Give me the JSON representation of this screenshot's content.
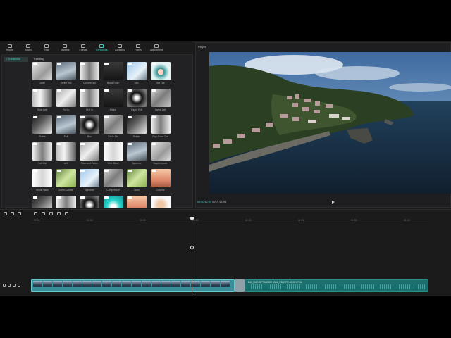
{
  "toolbar": {
    "items": [
      {
        "label": "Import",
        "icon": "import-icon"
      },
      {
        "label": "Audio",
        "icon": "audio-icon"
      },
      {
        "label": "Text",
        "icon": "text-icon"
      },
      {
        "label": "Stickers",
        "icon": "stickers-icon"
      },
      {
        "label": "Effects",
        "icon": "effects-icon"
      },
      {
        "label": "Transitions",
        "icon": "transitions-icon",
        "active": true
      },
      {
        "label": "Captions",
        "icon": "captions-icon"
      },
      {
        "label": "Filters",
        "icon": "filters-icon"
      },
      {
        "label": "Adjustment",
        "icon": "adjustment-icon"
      }
    ]
  },
  "leftpanel": {
    "category": "• Transitions",
    "section": "Trending",
    "items": [
      "Slide",
      "Scribe Bot",
      "Compress II",
      "Black Fade",
      "Mix",
      "Get Out",
      "Slide Left",
      "Pull In",
      "Pull In",
      "Blinds",
      "Paper Roll",
      "Swipe Left",
      "Shake",
      "Pull",
      "Blur",
      "Circle Sth",
      "Rotate",
      "Pop Zoom Out",
      "Pull Out",
      "Left",
      "Diamond Zoom",
      "Grid Gloss",
      "Squeeze",
      "Superimpose",
      "White Flash",
      "Zoom Canvas",
      "Shimmer",
      "Compressor",
      "Cube",
      "Colorful",
      "",
      "",
      "",
      "",
      "",
      ""
    ],
    "thumb_classes": [
      "t1",
      "t2",
      "t3",
      "t4",
      "t5",
      "t6",
      "t7",
      "t8",
      "t3",
      "t4",
      "t9",
      "t10",
      "t13",
      "t2",
      "t9",
      "t10",
      "t13",
      "t3",
      "t3",
      "t7",
      "t8",
      "t11",
      "t2",
      "t1",
      "t11",
      "t12",
      "t5",
      "t10",
      "t12",
      "t14",
      "t13",
      "t3",
      "t9",
      "t15",
      "t14",
      "t16"
    ]
  },
  "player": {
    "title": "Player",
    "current_time": "00:00:12:05",
    "duration": "00:07:21:04"
  },
  "timeline": {
    "ticks": [
      "00:00",
      "00:15",
      "00:30",
      "00:45",
      "01:00",
      "01:15",
      "01:30",
      "01:45"
    ],
    "audio_clip_name": "DJI_0000 OPTIMIZER 0001_STAPPR  00:00:07:04"
  }
}
